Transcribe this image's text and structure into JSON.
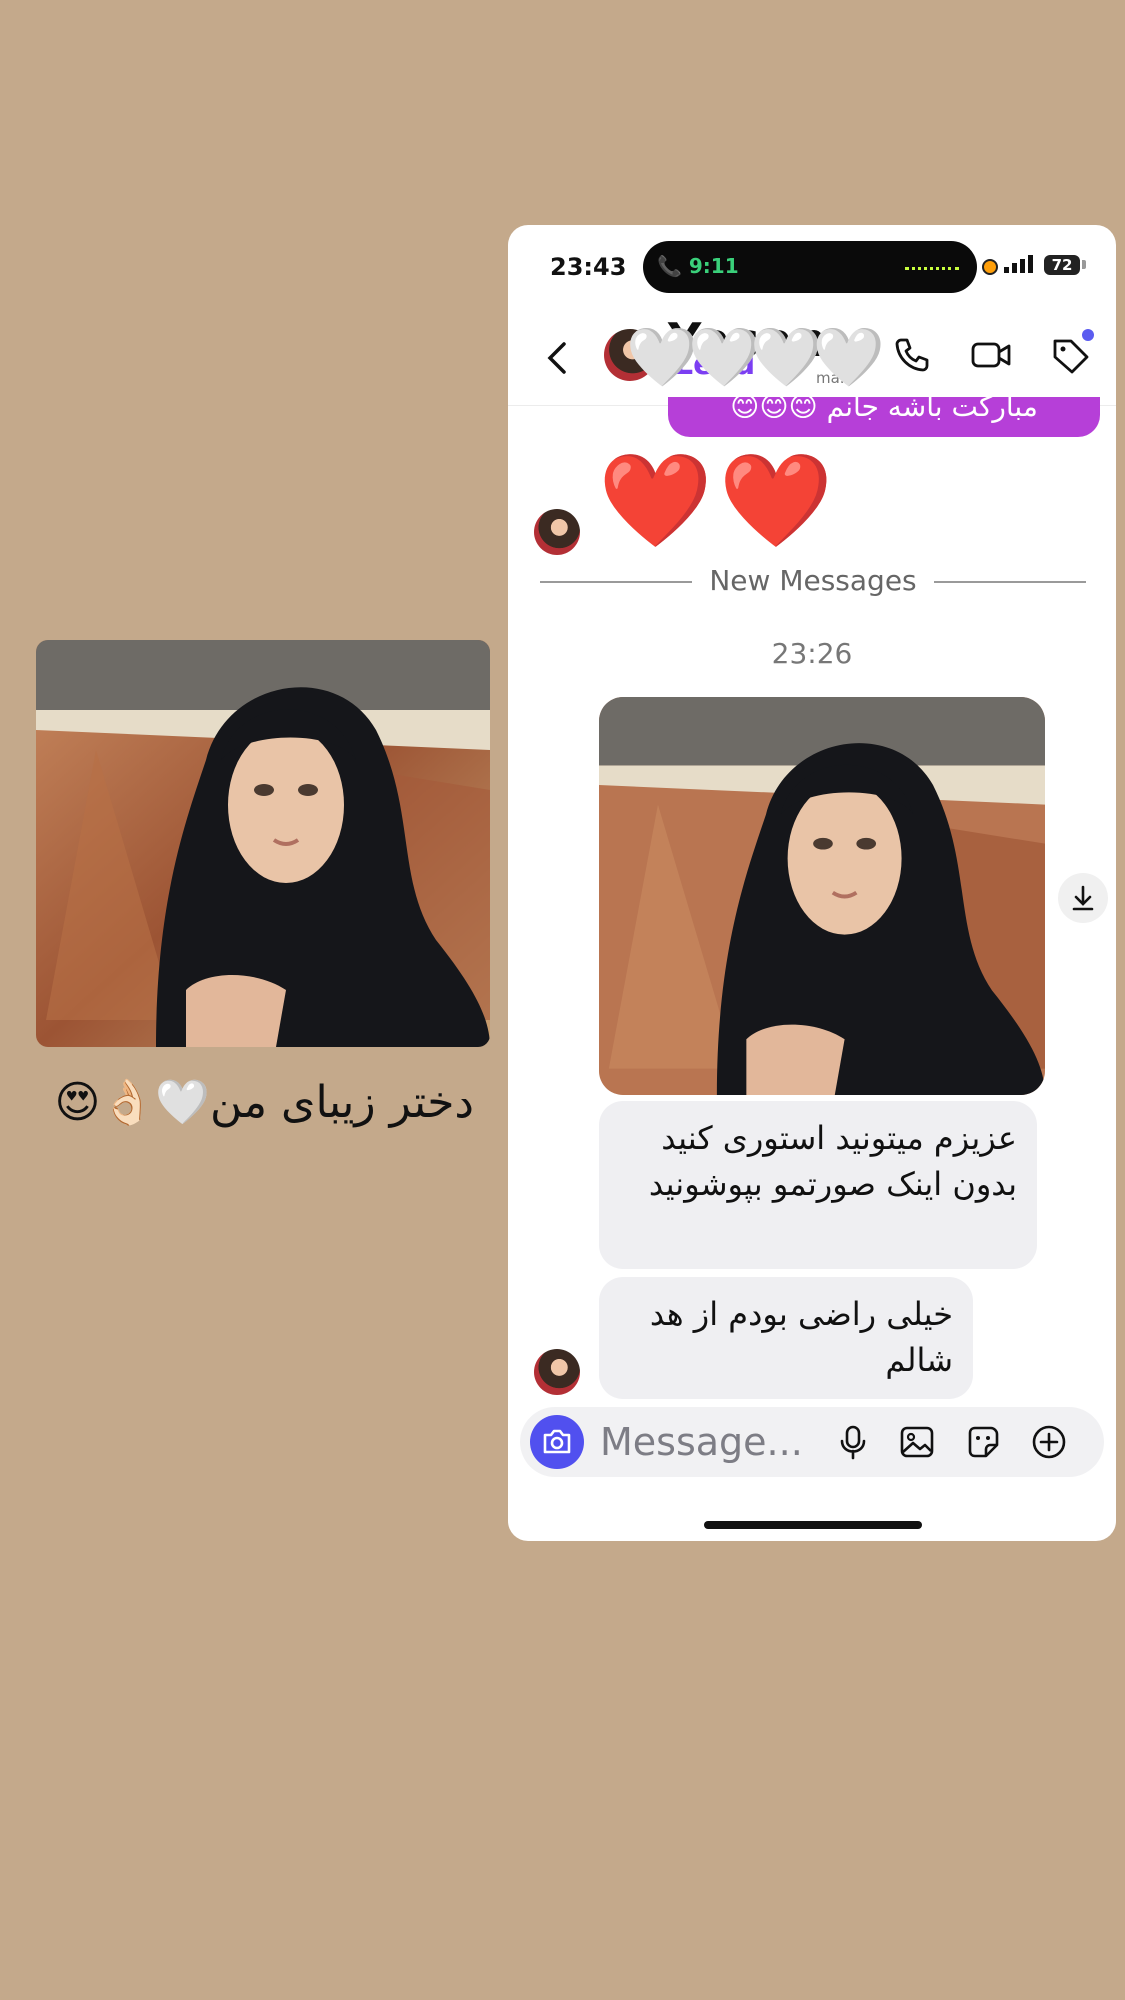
{
  "story": {
    "caption": "دختر زیبای من",
    "caption_emojis": "🤍👌🏻😍"
  },
  "status_bar": {
    "time": "23:43",
    "call_time": "9:11",
    "battery": "72"
  },
  "chat_header": {
    "name": "Yasam",
    "subtitle": "Lead",
    "sub_small": "ma...",
    "hearts": "🤍🤍🤍🤍"
  },
  "messages": {
    "previous_bubble_text": "مبارکت باشه جانم 😊😊😊",
    "big_hearts": "❤️❤️",
    "new_messages_label": "New Messages",
    "timestamp": "23:26",
    "bubble1": "عزیزم میتونید استوری کنید بدون اینک صورتمو بپوشونید",
    "bubble2": "خیلی راضی بودم از هد شالم"
  },
  "composer": {
    "placeholder": "Message..."
  },
  "colors": {
    "page_bg": "#c4a98b",
    "accent": "#5150ef",
    "sent_bubble": "#b63fd8",
    "lead_purple": "#7b3ef2"
  },
  "icons": [
    "back-chevron-icon",
    "phone-icon",
    "video-camera-icon",
    "tag-icon",
    "camera-icon",
    "microphone-icon",
    "gallery-icon",
    "sticker-icon",
    "plus-circle-icon",
    "download-icon"
  ]
}
